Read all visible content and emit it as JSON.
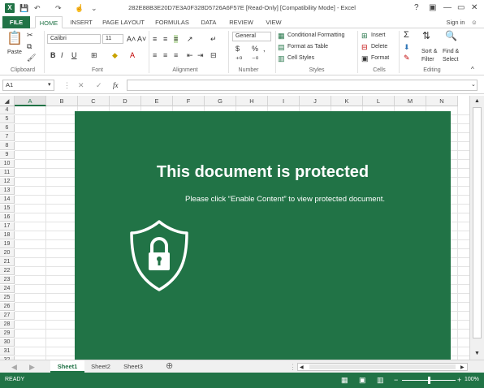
{
  "titlebar": {
    "title": "282E88B3E20D7E3A0F328D5726A6F57E  [Read-Only]  [Compatibility Mode] - Excel",
    "help": "?",
    "minimize": "—",
    "restore": "▭",
    "close": "✕"
  },
  "tabs": [
    "FILE",
    "HOME",
    "INSERT",
    "PAGE LAYOUT",
    "FORMULAS",
    "DATA",
    "REVIEW",
    "VIEW"
  ],
  "signin": "Sign in",
  "ribbon": {
    "clipboard": {
      "paste": "Paste",
      "label": "Clipboard"
    },
    "font": {
      "name": "Calibri",
      "size": "11",
      "label": "Font",
      "bold": "B",
      "italic": "I",
      "underline": "U"
    },
    "alignment": {
      "label": "Alignment"
    },
    "number": {
      "format": "General",
      "currency": "$",
      "percent": "%",
      "comma": ",",
      "label": "Number"
    },
    "styles": {
      "conditional": "Conditional Formatting",
      "table": "Format as Table",
      "cell": "Cell Styles",
      "label": "Styles"
    },
    "cells": {
      "insert": "Insert",
      "delete": "Delete",
      "format": "Format",
      "label": "Cells"
    },
    "editing": {
      "sum": "Σ",
      "sort": "Sort &",
      "sort2": "Filter",
      "find": "Find &",
      "find2": "Select",
      "label": "Editing"
    }
  },
  "formula_bar": {
    "name_box": "A1",
    "fx": "fx",
    "cancel": "✕",
    "enter": "✓"
  },
  "columns": [
    "A",
    "B",
    "C",
    "D",
    "E",
    "F",
    "G",
    "H",
    "I",
    "J",
    "K",
    "L",
    "M",
    "N"
  ],
  "rows": [
    "4",
    "5",
    "6",
    "7",
    "8",
    "9",
    "10",
    "11",
    "12",
    "13",
    "14",
    "15",
    "16",
    "17",
    "18",
    "19",
    "20",
    "21",
    "22",
    "23",
    "24",
    "25",
    "26",
    "27",
    "28",
    "29",
    "30",
    "31",
    "32"
  ],
  "banner": {
    "heading": "This document is protected",
    "message": "Please click “Enable Content” to view protected document."
  },
  "sheets": [
    "Sheet1",
    "Sheet2",
    "Sheet3"
  ],
  "add_sheet": "⊕",
  "status": {
    "ready": "READY",
    "zoom": "100%",
    "minus": "−",
    "plus": "+"
  },
  "colors": {
    "accent": "#217346"
  }
}
